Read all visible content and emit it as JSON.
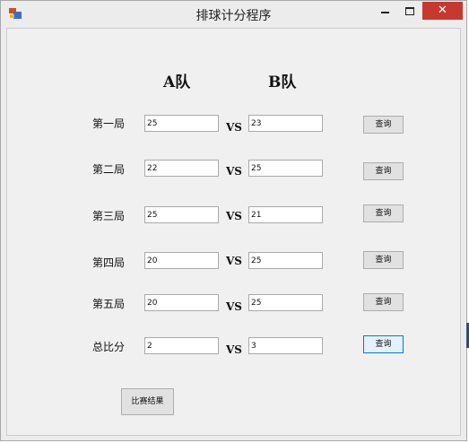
{
  "window": {
    "title": "排球计分程序",
    "close_glyph": "✕"
  },
  "teams": {
    "a": "A队",
    "b": "B队"
  },
  "vs_label": "VS",
  "rows": [
    {
      "label": "第一局",
      "a": "25",
      "b": "23",
      "button": "查询"
    },
    {
      "label": "第二局",
      "a": "22",
      "b": "25",
      "button": "查询"
    },
    {
      "label": "第三局",
      "a": "25",
      "b": "21",
      "button": "查询"
    },
    {
      "label": "第四局",
      "a": "20",
      "b": "25",
      "button": "查询"
    },
    {
      "label": "第五局",
      "a": "20",
      "b": "25",
      "button": "查询"
    },
    {
      "label": "总比分",
      "a": "2",
      "b": "3",
      "button": "查询"
    }
  ],
  "result_button": "比赛结果",
  "colors": {
    "close_button": "#c7392f",
    "focus_border": "#0078d7"
  }
}
